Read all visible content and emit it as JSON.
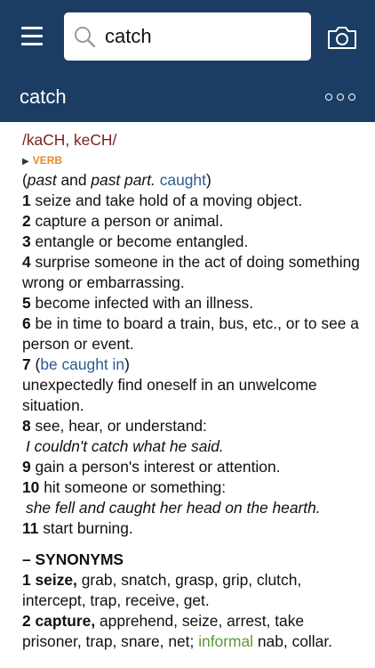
{
  "search": {
    "value": "catch"
  },
  "header": {
    "title": "catch"
  },
  "entry": {
    "pronunciation": "/kaCH, keCH/",
    "part_of_speech": "VERB",
    "inflection": {
      "open": "(",
      "past": "past",
      "and": " and ",
      "past_part": "past part.",
      "form": "caught",
      "close": ")"
    },
    "senses": [
      {
        "num": "1",
        "text": "seize and take hold of a moving object."
      },
      {
        "num": "2",
        "text": "capture a person or animal."
      },
      {
        "num": "3",
        "text": "entangle or become entangled."
      },
      {
        "num": "4",
        "text": "surprise someone in the act of doing something wrong or embarrassing."
      },
      {
        "num": "5",
        "text": "become infected with an illness."
      },
      {
        "num": "6",
        "text": "be in time to board a train, bus, etc., or to see a person or event."
      },
      {
        "num": "7",
        "phrase_open": "(",
        "phrase": "be caught in",
        "phrase_close": ")",
        "text": "unexpectedly find oneself in an unwelcome situation."
      },
      {
        "num": "8",
        "text": "see, hear, or understand:",
        "example": "I couldn't catch what he said."
      },
      {
        "num": "9",
        "text": "gain a person's interest or attention."
      },
      {
        "num": "10",
        "text": "hit someone or something:",
        "example": "she fell and caught her head on the hearth."
      },
      {
        "num": "11",
        "text": "start burning."
      }
    ],
    "synonyms_heading": "– SYNONYMS",
    "synonyms": [
      {
        "num": "1",
        "head": "seize,",
        "text": "grab, snatch, grasp, grip, clutch, intercept, trap, receive, get."
      },
      {
        "num": "2",
        "head": "capture,",
        "text": "apprehend, seize, arrest, take prisoner, trap, snare, net;",
        "register": "informal",
        "text2": "nab, collar."
      }
    ]
  },
  "colors": {
    "header_bg": "#1c3d63",
    "pronunciation": "#7a1f1f",
    "part_of_speech": "#e58a2a",
    "link": "#2c5d93",
    "register": "#5e9a35"
  },
  "icons": [
    "menu-icon",
    "search-icon",
    "camera-icon",
    "more-icon"
  ]
}
